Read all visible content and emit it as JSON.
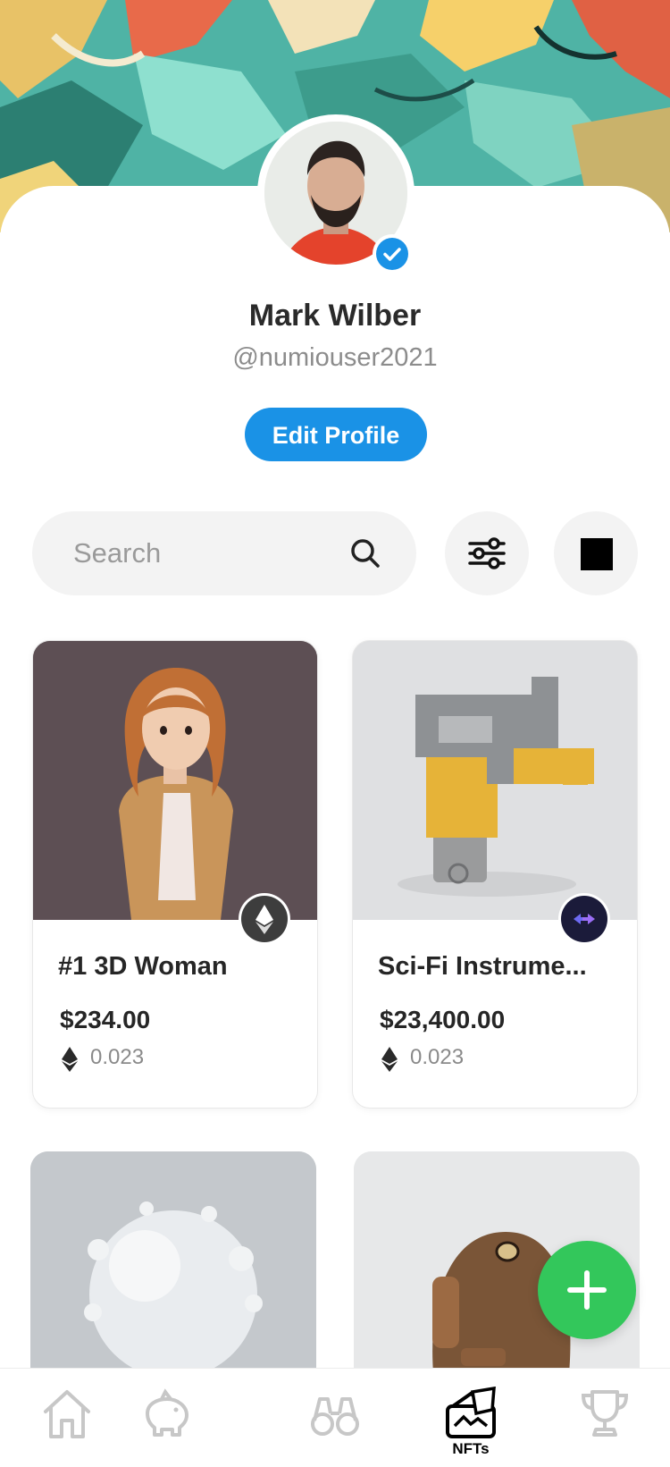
{
  "profile": {
    "name": "Mark Wilber",
    "handle": "@numiouser2021",
    "edit_label": "Edit Profile",
    "verified": true
  },
  "search": {
    "placeholder": "Search"
  },
  "nfts": [
    {
      "title": "#1 3D Woman",
      "price": "$234.00",
      "eth": "0.023",
      "chain_icon": "ethereum-icon"
    },
    {
      "title": "Sci-Fi Instrume...",
      "price": "$23,400.00",
      "eth": "0.023",
      "chain_icon": "bridge-arrows-icon"
    }
  ],
  "nav": {
    "items": [
      {
        "icon": "home-icon",
        "label": ""
      },
      {
        "icon": "piggy-bank-icon",
        "label": ""
      },
      {
        "icon": "binoculars-icon",
        "label": ""
      },
      {
        "icon": "nfts-icon",
        "label": "NFTs",
        "active": true
      },
      {
        "icon": "trophy-icon",
        "label": ""
      }
    ]
  },
  "colors": {
    "accent": "#1a92e6",
    "fab": "#33c75b",
    "search_bg": "#f3f3f3"
  }
}
